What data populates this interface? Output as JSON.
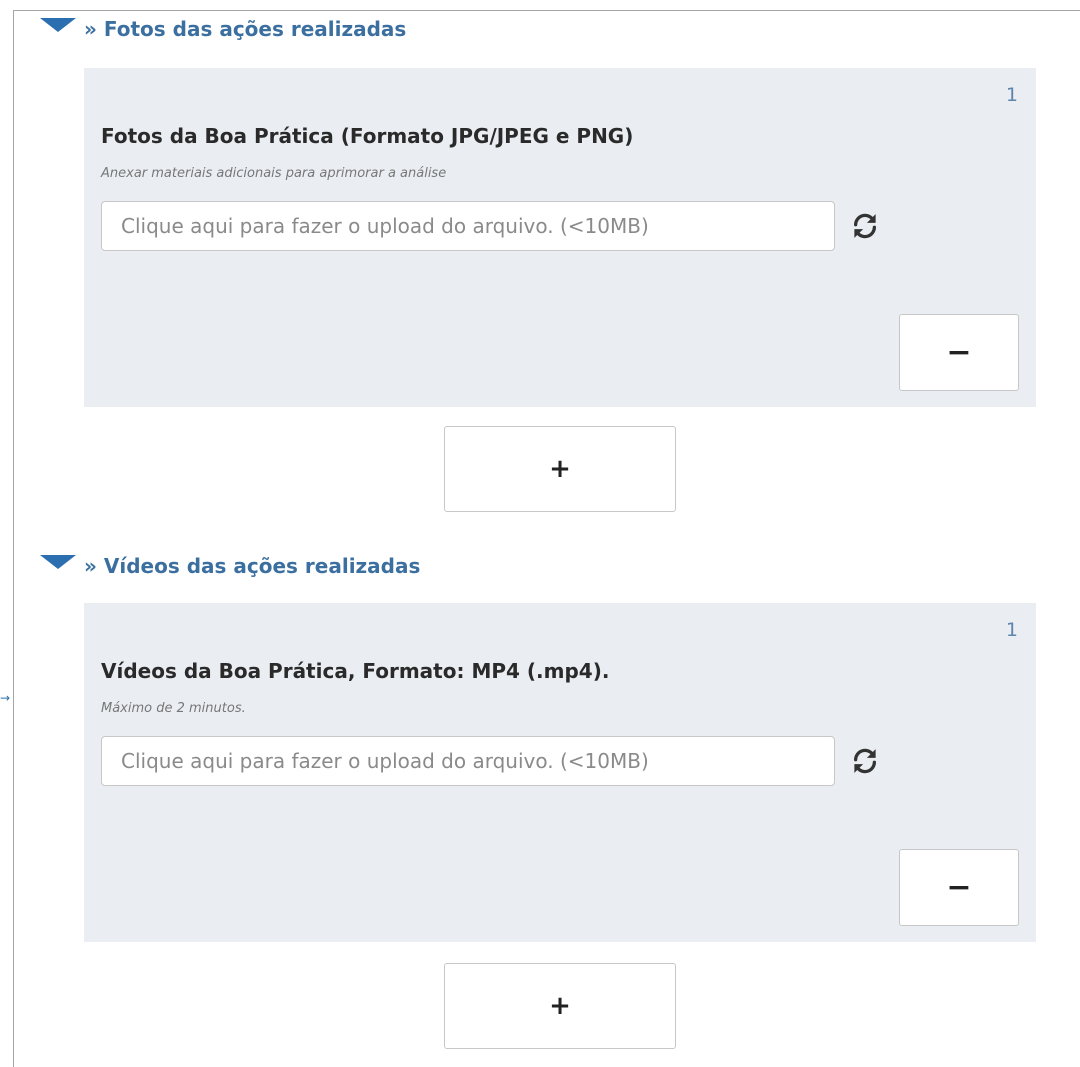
{
  "colors": {
    "accent": "#2c6fb0",
    "section_title": "#3b6fa0",
    "panel_bg": "#eaeef2",
    "index_text": "#5e86ad"
  },
  "photos_section": {
    "caret_icon": "caret-down-icon",
    "title": "» Fotos das ações realizadas",
    "item": {
      "index": "1",
      "label": "Fotos da Boa Prática (Formato JPG/JPEG e PNG)",
      "help": "Anexar materiais adicionais para aprimorar a análise",
      "placeholder": "Clique aqui para fazer o upload do arquivo. (<10MB)",
      "refresh_icon": "refresh-icon",
      "remove_label": "−"
    },
    "add_label": "+"
  },
  "videos_section": {
    "caret_icon": "caret-down-icon",
    "title": "» Vídeos das ações realizadas",
    "item": {
      "index": "1",
      "label": "Vídeos da Boa Prática, Formato: MP4 (.mp4).",
      "help": "Máximo de 2 minutos.",
      "placeholder": "Clique aqui para fazer o upload do arquivo. (<10MB)",
      "refresh_icon": "refresh-icon",
      "remove_label": "−"
    },
    "add_label": "+"
  }
}
